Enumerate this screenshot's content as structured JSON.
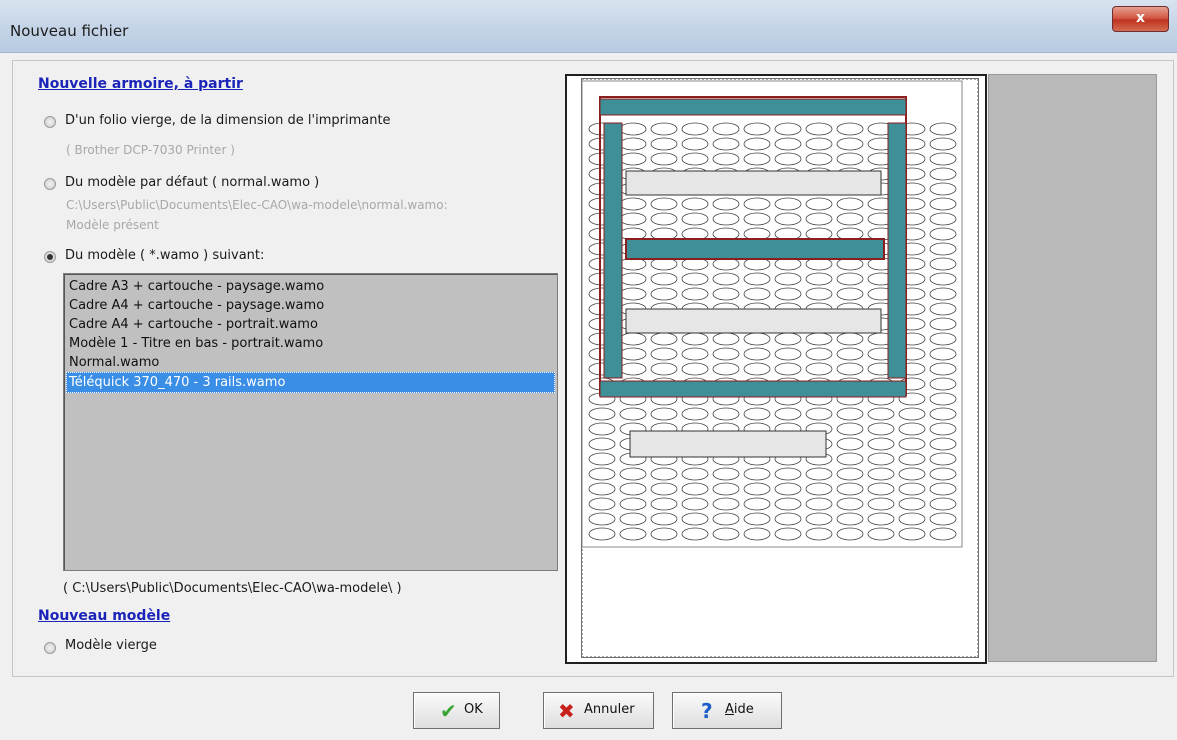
{
  "window": {
    "title": "Nouveau fichier",
    "close_glyph": "x"
  },
  "section_new_cabinet": {
    "heading": "Nouvelle armoire, à partir"
  },
  "options": {
    "blank_folio": {
      "label": "D'un folio vierge, de la dimension de l'imprimante",
      "printer": "( Brother DCP-7030 Printer )",
      "selected": false
    },
    "default_model": {
      "label": "Du modèle par défaut ( normal.wamo )",
      "path": "C:\\Users\\Public\\Documents\\Elec-CAO\\wa-modele\\normal.wamo:",
      "status": "Modèle présent",
      "selected": false
    },
    "following_model": {
      "label": "Du modèle ( *.wamo ) suivant:",
      "selected": true
    }
  },
  "model_list": {
    "items": [
      "Cadre A3 + cartouche - paysage.wamo",
      "Cadre A4 + cartouche - paysage.wamo",
      "Cadre A4 + cartouche - portrait.wamo",
      "Modèle 1 - Titre en bas - portrait.wamo",
      "Normal.wamo",
      "Téléquick 370_470 - 3 rails.wamo"
    ],
    "selected_index": 5,
    "directory": "( C:\\Users\\Public\\Documents\\Elec-CAO\\wa-modele\\ )"
  },
  "section_new_model": {
    "heading": "Nouveau modèle",
    "blank_model_label": "Modèle vierge",
    "selected": false
  },
  "buttons": {
    "ok": "OK",
    "cancel": "Annuler",
    "help_prefix": "",
    "help_accel": "A",
    "help_rest": "ide"
  },
  "icons": {
    "ok": "check-icon",
    "cancel": "x-icon",
    "help": "question-icon"
  },
  "colors": {
    "heading": "#1b24b8",
    "selection": "#3a8ee6",
    "rail": "#3e8f98",
    "frame": "#8b1f1f",
    "check": "#3aa535",
    "cancel": "#c8211b",
    "help": "#1d5fc8"
  }
}
